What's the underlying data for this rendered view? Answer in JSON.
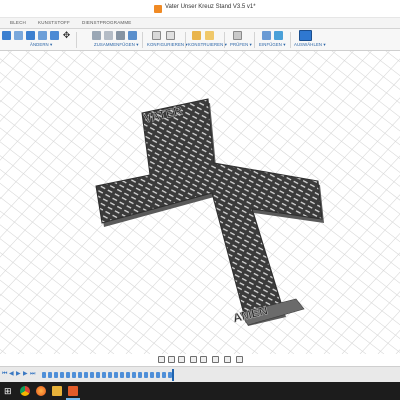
{
  "window": {
    "title": "Vater Unser Kreuz Stand V3.5 v1*"
  },
  "tabs": [
    "BLECH",
    "KUNSTSTOFF",
    "DIENSTPROGRAMME"
  ],
  "ribbon_groups": [
    {
      "label": "ÄNDERN ▾"
    },
    {
      "label": "ZUSAMMENFÜGEN ▾"
    },
    {
      "label": "KONFIGURIEREN ▾"
    },
    {
      "label": "KONSTRUIEREN ▾"
    },
    {
      "label": "PRÜFEN ▾"
    },
    {
      "label": "EINFÜGEN ▾"
    },
    {
      "label": "AUSWÄHLEN ▾"
    }
  ],
  "model": {
    "top_text": "VATER",
    "bottom_text": "AMEN",
    "body_color": "#3b3b3b",
    "edge_color": "#5a5a5a"
  },
  "nav_icons": [
    "move-icon",
    "pan-icon",
    "orbit-icon",
    "zoom-icon",
    "fit-icon",
    "display-icon",
    "grid-icon",
    "viewports-icon"
  ],
  "timeline_controls": [
    "⏮",
    "◀",
    "▶",
    "▶",
    "⏭"
  ],
  "taskbar_icons": [
    "start-icon",
    "chrome-icon",
    "firefox-icon",
    "file-explorer-icon",
    "fusion-icon"
  ],
  "colors": {
    "accent": "#2a64a6",
    "grid": "#d9d9d9",
    "taskbar": "#1c1c1c"
  }
}
